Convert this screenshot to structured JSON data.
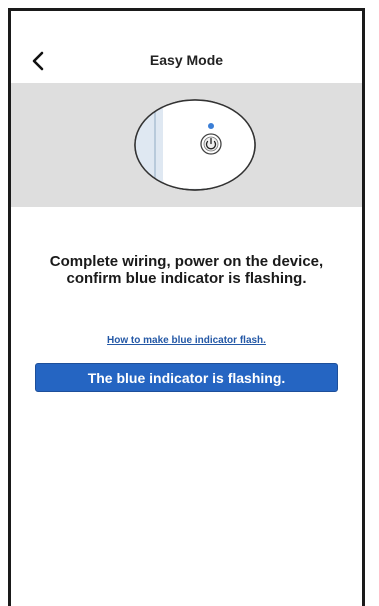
{
  "header": {
    "title": "Easy Mode",
    "back_icon": "chevron-left-icon"
  },
  "hero": {
    "image": "device-power-button-illustration",
    "indicator_color": "#3b7ed6"
  },
  "instruction": {
    "text": "Complete wiring, power on the device, confirm blue indicator is flashing."
  },
  "help": {
    "link_text": "How to make blue indicator flash."
  },
  "confirm": {
    "button_label": "The blue indicator is flashing.",
    "color": "#2565c2"
  }
}
